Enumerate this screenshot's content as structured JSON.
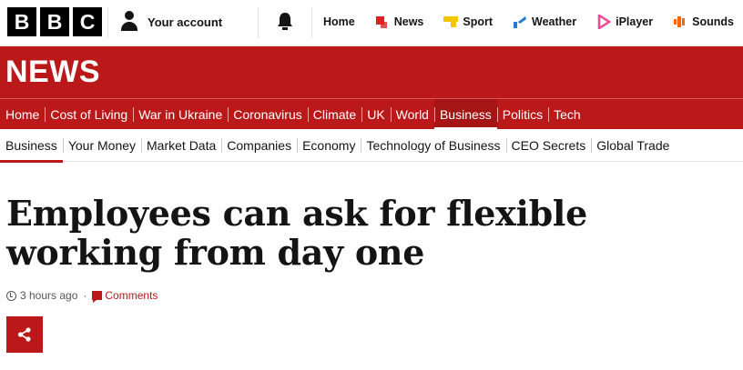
{
  "logo": {
    "letters": [
      "B",
      "B",
      "C"
    ]
  },
  "account": {
    "label": "Your account"
  },
  "nav_links": [
    {
      "label": "Home",
      "icon": "home",
      "color": ""
    },
    {
      "label": "News",
      "icon": "news-icon",
      "color": "#e02020"
    },
    {
      "label": "Sport",
      "icon": "sport-icon",
      "color": "#f2c600"
    },
    {
      "label": "Weather",
      "icon": "weather-icon",
      "color": "#1e7bd6"
    },
    {
      "label": "iPlayer",
      "icon": "iplayer-icon",
      "color": "#f54997"
    },
    {
      "label": "Sounds",
      "icon": "sounds-icon",
      "color": "#ff6600"
    }
  ],
  "banner": {
    "title": "NEWS"
  },
  "primary_nav": [
    {
      "label": "Home",
      "active": false
    },
    {
      "label": "Cost of Living",
      "active": false
    },
    {
      "label": "War in Ukraine",
      "active": false
    },
    {
      "label": "Coronavirus",
      "active": false
    },
    {
      "label": "Climate",
      "active": false
    },
    {
      "label": "UK",
      "active": false
    },
    {
      "label": "World",
      "active": false
    },
    {
      "label": "Business",
      "active": true
    },
    {
      "label": "Politics",
      "active": false
    },
    {
      "label": "Tech",
      "active": false
    }
  ],
  "secondary_nav": [
    {
      "label": "Business",
      "active": true
    },
    {
      "label": "Your Money",
      "active": false
    },
    {
      "label": "Market Data",
      "active": false
    },
    {
      "label": "Companies",
      "active": false
    },
    {
      "label": "Economy",
      "active": false
    },
    {
      "label": "Technology of Business",
      "active": false
    },
    {
      "label": "CEO Secrets",
      "active": false
    },
    {
      "label": "Global Trade",
      "active": false
    }
  ],
  "article": {
    "headline": "Employees can ask for flexible working from day one",
    "timestamp": "3 hours ago",
    "separator": "·",
    "comments_label": "Comments"
  },
  "colors": {
    "brand_red": "#bb1919",
    "text": "#141414",
    "meta": "#545658"
  }
}
